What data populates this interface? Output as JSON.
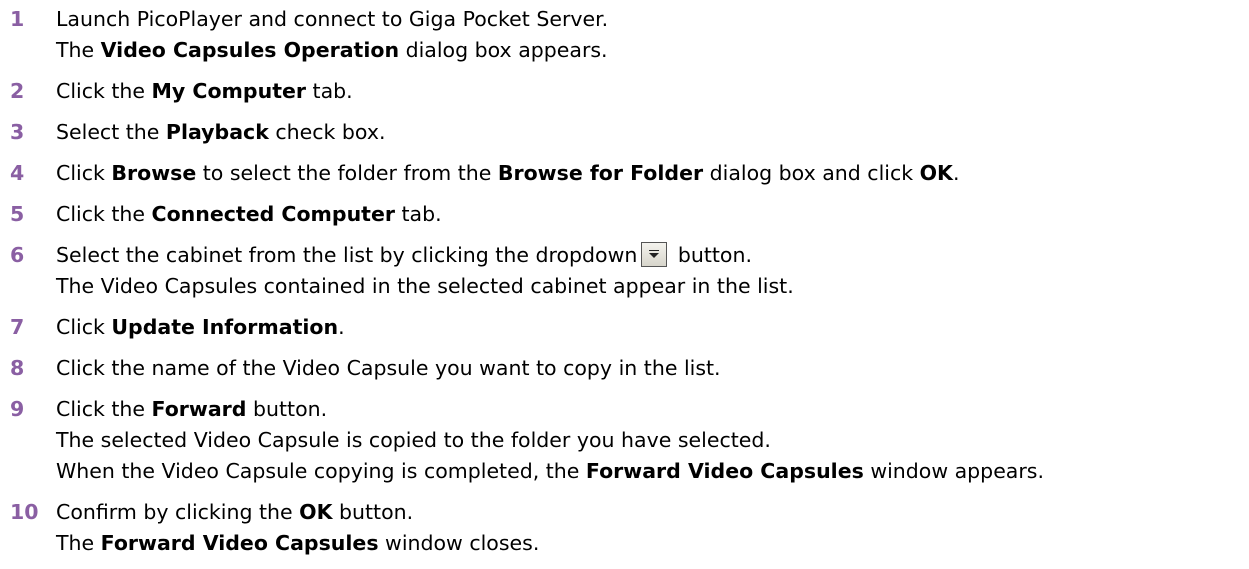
{
  "steps": [
    {
      "num": "1",
      "lines": [
        [
          "Launch PicoPlayer and connect to Giga Pocket Server."
        ],
        [
          "The ",
          "Video Capsules Operation",
          " dialog box appears."
        ]
      ]
    },
    {
      "num": "2",
      "lines": [
        [
          "Click the ",
          "My Computer",
          " tab."
        ]
      ]
    },
    {
      "num": "3",
      "lines": [
        [
          "Select the ",
          "Playback",
          " check box."
        ]
      ]
    },
    {
      "num": "4",
      "lines": [
        [
          "Click ",
          "Browse",
          " to select the folder from the ",
          "Browse for Folder",
          " dialog box and click ",
          "OK",
          "."
        ]
      ]
    },
    {
      "num": "5",
      "lines": [
        [
          "Click the ",
          "Connected Computer",
          " tab."
        ]
      ]
    },
    {
      "num": "6",
      "lines": [
        [
          "Select the cabinet from the list by clicking the dropdown",
          " button."
        ],
        [
          "The Video Capsules contained in the selected cabinet appear in the list."
        ]
      ]
    },
    {
      "num": "7",
      "lines": [
        [
          "Click ",
          "Update Information",
          "."
        ]
      ]
    },
    {
      "num": "8",
      "lines": [
        [
          "Click the name of the Video Capsule you want to copy in the list."
        ]
      ]
    },
    {
      "num": "9",
      "lines": [
        [
          "Click the ",
          "Forward",
          " button."
        ],
        [
          "The selected Video Capsule is copied to the folder you have selected."
        ],
        [
          "When the Video Capsule copying is completed, the ",
          "Forward Video Capsules",
          " window appears."
        ]
      ]
    },
    {
      "num": "10",
      "lines": [
        [
          "Confirm by clicking the ",
          "OK",
          " button."
        ],
        [
          "The ",
          "Forward Video Capsules",
          " window closes."
        ]
      ]
    }
  ],
  "icons": {
    "dropdown": "dropdown-arrow-icon"
  },
  "colors": {
    "step_number": "#8a5fa3",
    "text": "#000000"
  }
}
